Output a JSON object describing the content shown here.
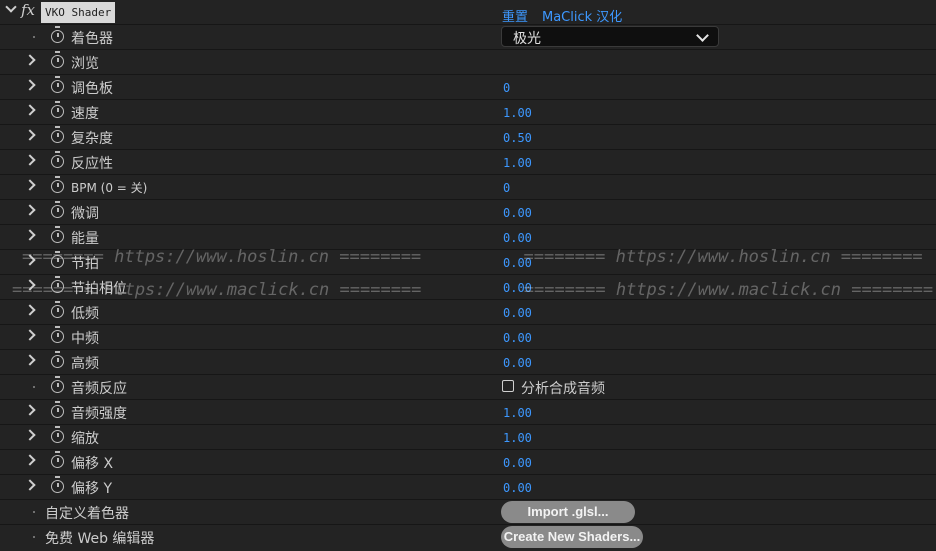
{
  "effect": {
    "name": "VKO Shader",
    "fx_label": "fx",
    "reset_label": "重置",
    "credit_label": "MaClick 汉化"
  },
  "params": {
    "shader": {
      "label": "着色器",
      "value": "极光"
    },
    "browse": {
      "label": "浏览"
    },
    "palette": {
      "label": "调色板",
      "value": "0"
    },
    "speed": {
      "label": "速度",
      "value": "1.00"
    },
    "complexity": {
      "label": "复杂度",
      "value": "0.50"
    },
    "reactivity": {
      "label": "反应性",
      "value": "1.00"
    },
    "bpm": {
      "label": "BPM (0 = 关)",
      "value": "0"
    },
    "fine_tune": {
      "label": "微调",
      "value": "0.00"
    },
    "energy": {
      "label": "能量",
      "value": "0.00"
    },
    "beat": {
      "label": "节拍",
      "value": "0.00"
    },
    "beat_phase": {
      "label": "节拍相位",
      "value": "0.00"
    },
    "low_freq": {
      "label": "低频",
      "value": "0.00"
    },
    "mid_freq": {
      "label": "中频",
      "value": "0.00"
    },
    "high_freq": {
      "label": "高频",
      "value": "0.00"
    },
    "audio_react": {
      "label": "音频反应",
      "checkbox_label": "分析合成音频",
      "checked": false
    },
    "audio_strength": {
      "label": "音频强度",
      "value": "1.00"
    },
    "scale": {
      "label": "缩放",
      "value": "1.00"
    },
    "offset_x": {
      "label": "偏移 X",
      "value": "0.00"
    },
    "offset_y": {
      "label": "偏移 Y",
      "value": "0.00"
    },
    "custom_shader": {
      "label": "自定义着色器",
      "button": "Import .glsl..."
    },
    "web_editor": {
      "label": "免费 Web 编辑器",
      "button": "Create New Shaders..."
    }
  },
  "watermarks": {
    "line1": "======== https://www.hoslin.cn ========          ======== https://www.hoslin.cn ========",
    "line2": "======== https://www.maclick.cn ========          ======== https://www.maclick.cn ========"
  },
  "colors": {
    "background": "#232323",
    "value_blue": "#3d98ff",
    "button_gray": "#8a8a8a"
  }
}
